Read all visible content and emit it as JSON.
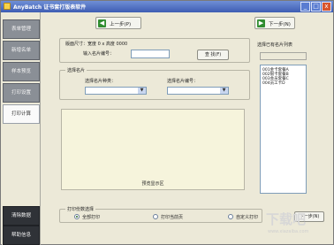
{
  "window": {
    "title": "AnyBatch 证书套打版表软件",
    "controls": {
      "minimize": "_",
      "maximize": "□",
      "close": "x"
    }
  },
  "sidebar": {
    "items": [
      {
        "label": "表单管理"
      },
      {
        "label": "新增名单"
      },
      {
        "label": "样本预览"
      },
      {
        "label": "打印设置"
      },
      {
        "label": "打印计算"
      }
    ],
    "bottom_items": [
      {
        "label": "清除数据"
      },
      {
        "label": "帮助信息"
      }
    ]
  },
  "toolbar": {
    "back_label": "上一步(P)",
    "next_label": "下一步(N)",
    "back_icon": "arrow-left-icon",
    "next_icon": "arrow-right-icon"
  },
  "form": {
    "range_label": "版面尺寸：宽度 0 x 高度 0000",
    "input_label": "输入名片编号：",
    "query_button": "查 找(F)",
    "search_group_title": "选择名片",
    "select_left_label": "选择名片种类：",
    "select_right_label": "选择名片编号：",
    "preview_label": "预览显示区"
  },
  "right_panel": {
    "title": "选择已有名片列表",
    "list_items": [
      "001金卡套餐A",
      "002银卡套餐B",
      "003会员套餐C",
      "004员工卡D"
    ]
  },
  "bottom": {
    "group_title": "打印份数选择",
    "radio_options": [
      {
        "label": "全部打印",
        "checked": true
      },
      {
        "label": "打印当前页",
        "checked": false
      },
      {
        "label": "自定义打印",
        "checked": false
      }
    ],
    "finish_button": "下一步(N)"
  },
  "watermark": {
    "text": "下载吧",
    "url": "www.xiazaiba.com"
  }
}
